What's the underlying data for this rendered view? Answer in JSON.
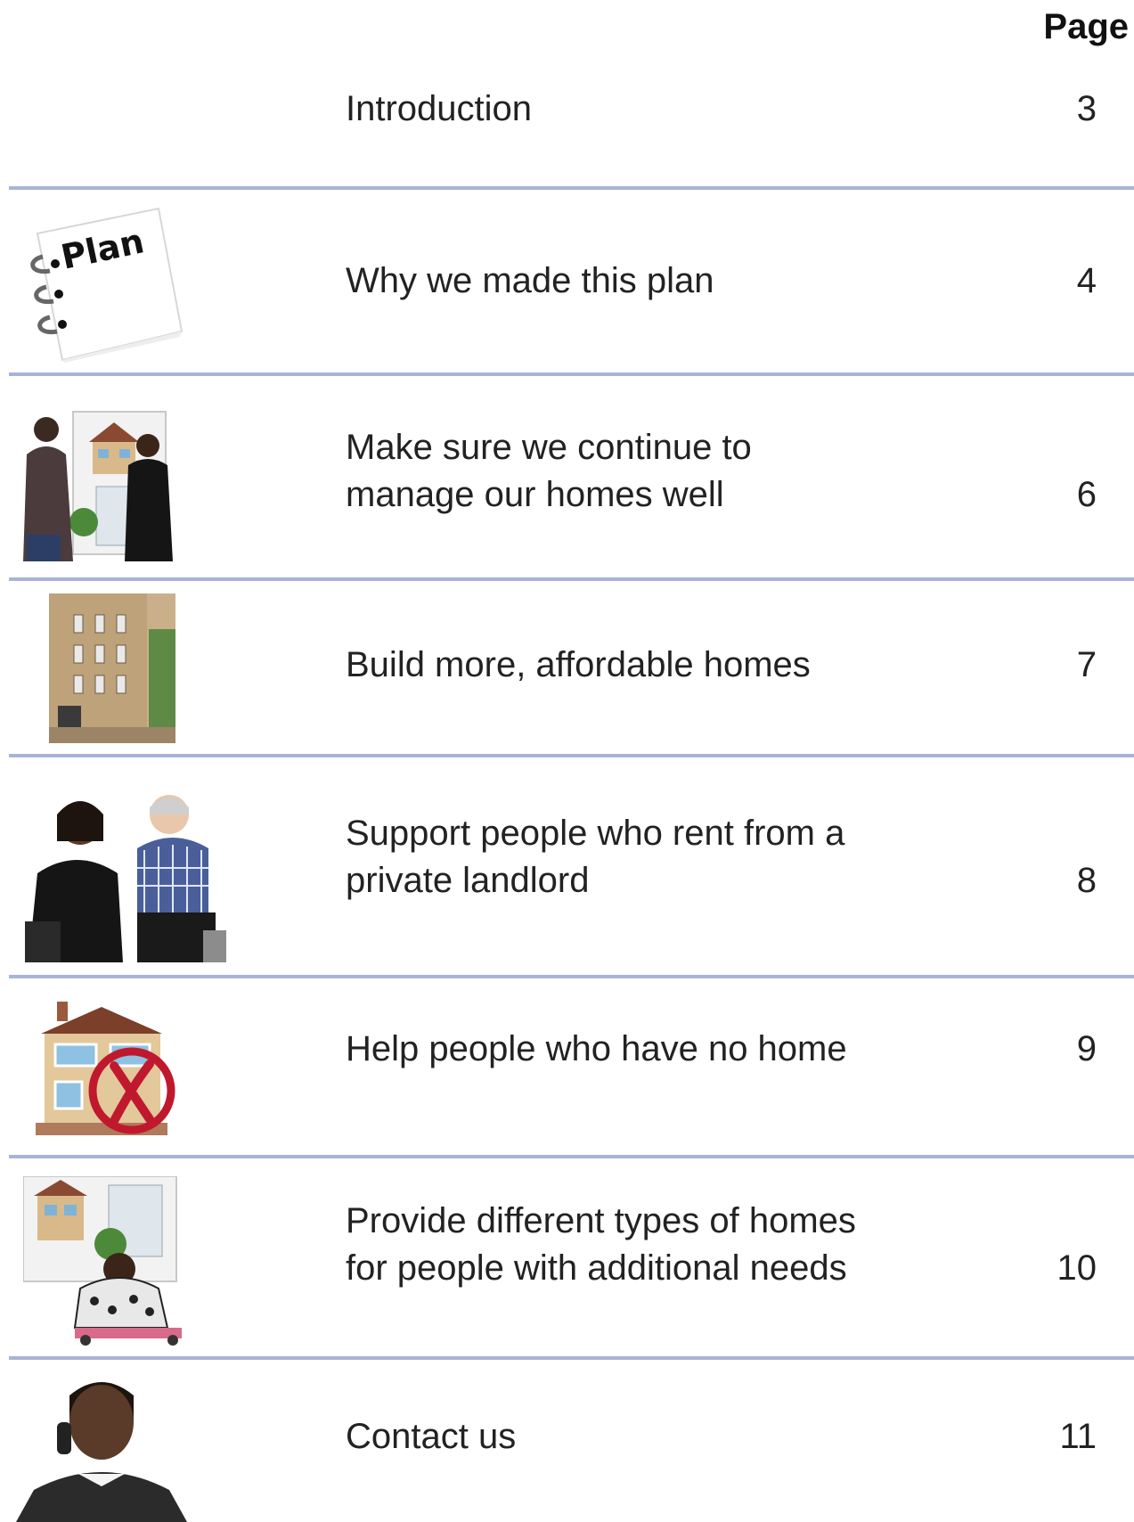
{
  "header": {
    "page_label": "Page"
  },
  "entries": [
    {
      "title_lines": [
        "Introduction"
      ],
      "page": "3",
      "picture": "none"
    },
    {
      "title_lines": [
        "Why we made this plan"
      ],
      "page": "4",
      "picture": "plan-notebook",
      "picture_text": "Plan"
    },
    {
      "title_lines": [
        "Make sure we continue to",
        "manage our homes well"
      ],
      "page": "6",
      "picture": "two-people-with-house-picture"
    },
    {
      "title_lines": [
        "Build more, affordable homes"
      ],
      "page": "7",
      "picture": "apartment-building"
    },
    {
      "title_lines": [
        "Support people who rent from a",
        "private landlord"
      ],
      "page": "8",
      "picture": "two-people-talking"
    },
    {
      "title_lines": [
        "Help people who have no home"
      ],
      "page": "9",
      "picture": "house-with-red-cross"
    },
    {
      "title_lines": [
        "Provide different types of homes",
        "for people with additional needs"
      ],
      "page": "10",
      "picture": "wheelchair-user-with-homes"
    },
    {
      "title_lines": [
        "Contact us"
      ],
      "page": "11",
      "picture": "woman-on-phone"
    }
  ],
  "colors": {
    "divider": "#a9b3d6",
    "text": "#222222",
    "cross": "#c0192d"
  }
}
